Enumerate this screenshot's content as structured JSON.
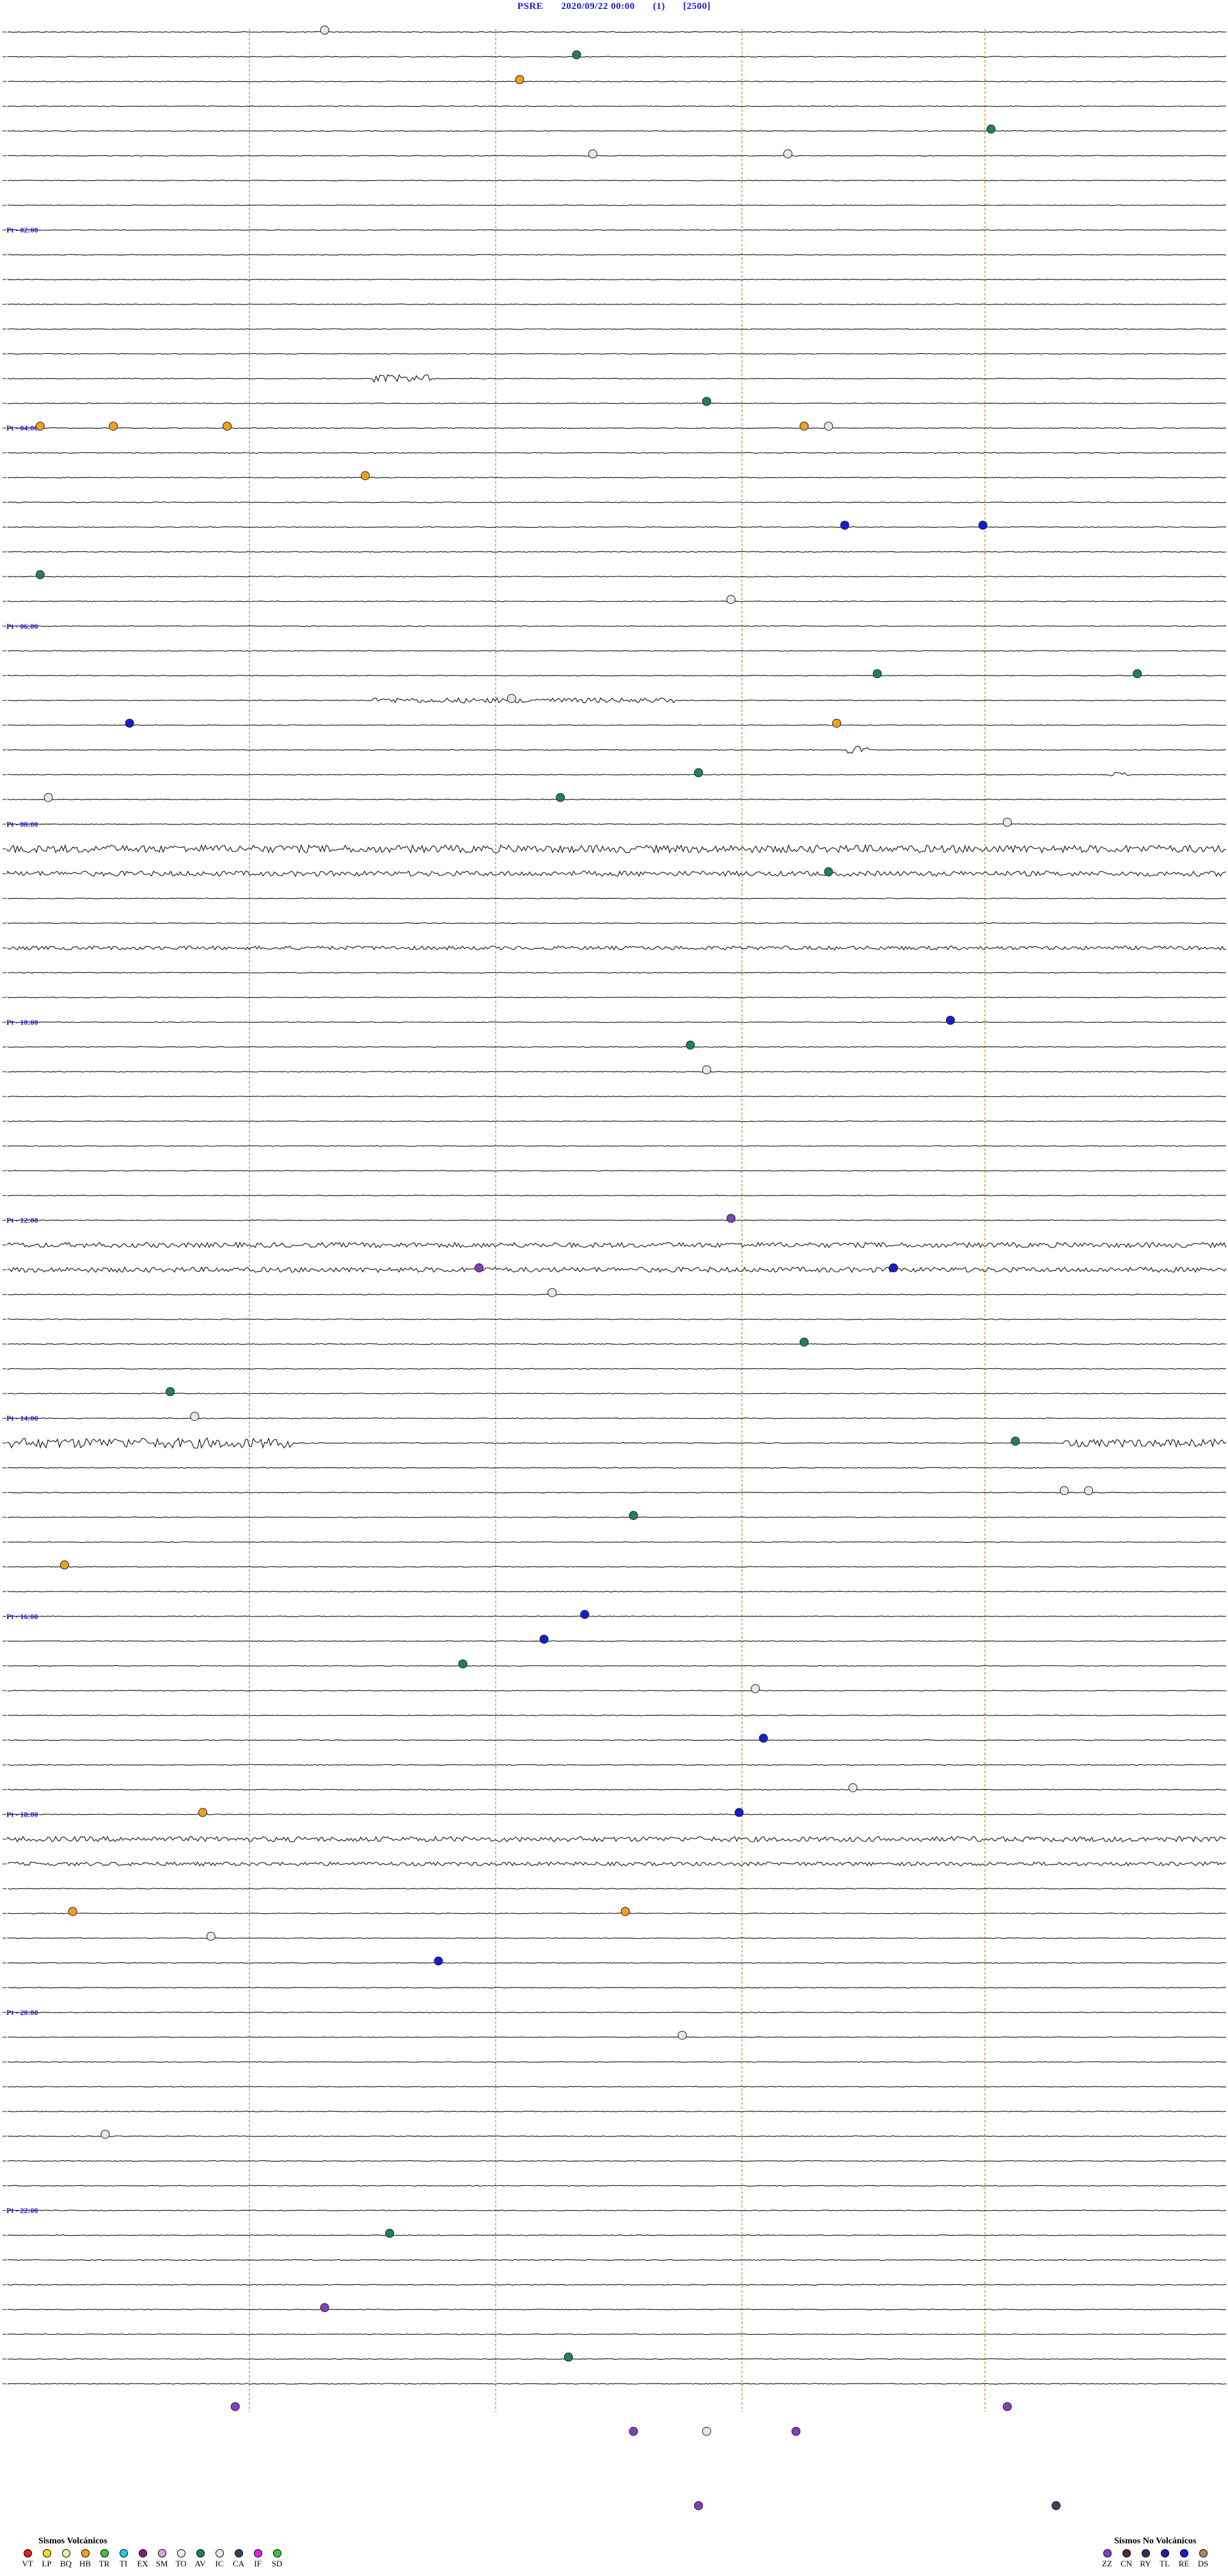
{
  "header": {
    "station": "PSRE",
    "datetime": "2020/09/22 00:00",
    "component": "(1)",
    "scale": "[2500]"
  },
  "colors": {
    "trace": "#111111",
    "minute_marker": "#e07a2a",
    "hour_label": "#1a1ad0",
    "minute_tick": "#c0392b"
  },
  "chart_data": {
    "type": "helicorder",
    "hour_labels": [
      "02:00",
      "04:00",
      "06:00",
      "08:00",
      "10:00",
      "12:00",
      "14:00",
      "16:00",
      "18:00",
      "20:00",
      "22:00"
    ],
    "line_count": 96,
    "line_minutes": 15,
    "events": [
      {
        "line": 0,
        "minute": 3.9,
        "type": "IC"
      },
      {
        "line": 1,
        "minute": 7.0,
        "type": "AV"
      },
      {
        "line": 2,
        "minute": 6.3,
        "type": "HB"
      },
      {
        "line": 4,
        "minute": 12.1,
        "type": "AV"
      },
      {
        "line": 5,
        "minute": 7.2,
        "type": "IC"
      },
      {
        "line": 5,
        "minute": 9.6,
        "type": "IC"
      },
      {
        "line": 15,
        "minute": 8.6,
        "type": "AV"
      },
      {
        "line": 16,
        "minute": 10.1,
        "type": "IC"
      },
      {
        "line": 16,
        "minute": 0.4,
        "type": "HB"
      },
      {
        "line": 16,
        "minute": 1.3,
        "type": "HB"
      },
      {
        "line": 16,
        "minute": 2.7,
        "type": "HB"
      },
      {
        "line": 16,
        "minute": 9.8,
        "type": "HB"
      },
      {
        "line": 18,
        "minute": 4.4,
        "type": "HB"
      },
      {
        "line": 20,
        "minute": 10.3,
        "type": "RE"
      },
      {
        "line": 20,
        "minute": 12.0,
        "type": "RE"
      },
      {
        "line": 22,
        "minute": 0.4,
        "type": "AV"
      },
      {
        "line": 23,
        "minute": 8.9,
        "type": "IC"
      },
      {
        "line": 26,
        "minute": 10.7,
        "type": "AV"
      },
      {
        "line": 26,
        "minute": 13.9,
        "type": "AV"
      },
      {
        "line": 27,
        "minute": 6.2,
        "type": "IC"
      },
      {
        "line": 28,
        "minute": 1.5,
        "type": "RE"
      },
      {
        "line": 28,
        "minute": 10.2,
        "type": "HB"
      },
      {
        "line": 30,
        "minute": 8.5,
        "type": "AV"
      },
      {
        "line": 31,
        "minute": 0.5,
        "type": "IC"
      },
      {
        "line": 31,
        "minute": 6.8,
        "type": "AV"
      },
      {
        "line": 32,
        "minute": 12.3,
        "type": "IC"
      },
      {
        "line": 34,
        "minute": 10.1,
        "type": "AV"
      },
      {
        "line": 40,
        "minute": 11.6,
        "type": "RE"
      },
      {
        "line": 41,
        "minute": 8.4,
        "type": "AV"
      },
      {
        "line": 42,
        "minute": 8.6,
        "type": "IC"
      },
      {
        "line": 48,
        "minute": 8.9,
        "type": "ZZ"
      },
      {
        "line": 50,
        "minute": 5.8,
        "type": "ZZ"
      },
      {
        "line": 50,
        "minute": 10.9,
        "type": "RE"
      },
      {
        "line": 51,
        "minute": 6.7,
        "type": "IC"
      },
      {
        "line": 53,
        "minute": 9.8,
        "type": "AV"
      },
      {
        "line": 55,
        "minute": 2.0,
        "type": "AV"
      },
      {
        "line": 56,
        "minute": 2.3,
        "type": "IC"
      },
      {
        "line": 57,
        "minute": 12.4,
        "type": "AV"
      },
      {
        "line": 59,
        "minute": 13.0,
        "type": "IC"
      },
      {
        "line": 59,
        "minute": 13.3,
        "type": "IC"
      },
      {
        "line": 60,
        "minute": 7.7,
        "type": "AV"
      },
      {
        "line": 62,
        "minute": 0.7,
        "type": "HB"
      },
      {
        "line": 64,
        "minute": 7.1,
        "type": "RE"
      },
      {
        "line": 65,
        "minute": 6.6,
        "type": "RE"
      },
      {
        "line": 66,
        "minute": 5.6,
        "type": "AV"
      },
      {
        "line": 67,
        "minute": 9.2,
        "type": "IC"
      },
      {
        "line": 69,
        "minute": 9.3,
        "type": "RE"
      },
      {
        "line": 71,
        "minute": 10.4,
        "type": "IC"
      },
      {
        "line": 72,
        "minute": 9.0,
        "type": "RE"
      },
      {
        "line": 72,
        "minute": 2.4,
        "type": "HB"
      },
      {
        "line": 76,
        "minute": 0.8,
        "type": "HB"
      },
      {
        "line": 76,
        "minute": 7.6,
        "type": "HB"
      },
      {
        "line": 77,
        "minute": 2.5,
        "type": "IC"
      },
      {
        "line": 78,
        "minute": 5.3,
        "type": "RE"
      },
      {
        "line": 81,
        "minute": 8.3,
        "type": "IC"
      },
      {
        "line": 85,
        "minute": 1.2,
        "type": "IC"
      },
      {
        "line": 89,
        "minute": 4.7,
        "type": "AV"
      },
      {
        "line": 92,
        "minute": 3.9,
        "type": "ZZ"
      },
      {
        "line": 94,
        "minute": 6.9,
        "type": "AV"
      },
      {
        "line": 96,
        "minute": 2.8,
        "type": "ZZ"
      },
      {
        "line": 96,
        "minute": 12.3,
        "type": "ZZ"
      },
      {
        "line": 97,
        "minute": 7.7,
        "type": "ZZ"
      },
      {
        "line": 97,
        "minute": 8.6,
        "type": "IC"
      },
      {
        "line": 97,
        "minute": 9.7,
        "type": "ZZ"
      },
      {
        "line": 100,
        "minute": 8.5,
        "type": "ZZ"
      },
      {
        "line": 100,
        "minute": 12.9,
        "type": "CA"
      }
    ],
    "noise_bands": [
      {
        "line": 14,
        "from": 4.5,
        "to": 5.2,
        "amp": 3
      },
      {
        "line": 27,
        "from": 4.5,
        "to": 8.2,
        "amp": 2
      },
      {
        "line": 29,
        "from": 10.3,
        "to": 10.6,
        "amp": 3
      },
      {
        "line": 30,
        "from": 13.5,
        "to": 13.8,
        "amp": 2
      },
      {
        "line": 33,
        "from": 0.0,
        "to": 15.0,
        "amp": 3
      },
      {
        "line": 34,
        "from": 0.0,
        "to": 15.0,
        "amp": 2
      },
      {
        "line": 37,
        "from": 0.0,
        "to": 15.0,
        "amp": 1.5
      },
      {
        "line": 49,
        "from": 0.0,
        "to": 15.0,
        "amp": 2
      },
      {
        "line": 50,
        "from": 0.0,
        "to": 15.0,
        "amp": 2
      },
      {
        "line": 57,
        "from": 0.0,
        "to": 3.5,
        "amp": 4
      },
      {
        "line": 57,
        "from": 13.0,
        "to": 15.0,
        "amp": 3
      },
      {
        "line": 73,
        "from": 0.0,
        "to": 15.0,
        "amp": 2
      },
      {
        "line": 74,
        "from": 0.0,
        "to": 15.0,
        "amp": 1.5
      }
    ]
  },
  "legend": {
    "volcanic_title": "Sismos Volcánicos",
    "volcanic": [
      {
        "code": "VT",
        "color": "#e02020"
      },
      {
        "code": "LP",
        "color": "#f0e020"
      },
      {
        "code": "BQ",
        "color": "#f0f0a0"
      },
      {
        "code": "HB",
        "color": "#f0a020"
      },
      {
        "code": "TR",
        "color": "#40c040"
      },
      {
        "code": "TI",
        "color": "#20d0e0"
      },
      {
        "code": "EX",
        "color": "#802080"
      },
      {
        "code": "SM",
        "color": "#e0a0e0"
      },
      {
        "code": "TO",
        "color": "#f0f0f0"
      },
      {
        "code": "AV",
        "color": "#208060"
      },
      {
        "code": "IC",
        "color": "#e8e8e8"
      },
      {
        "code": "CA",
        "color": "#404060"
      },
      {
        "code": "IF",
        "color": "#e020e0"
      },
      {
        "code": "SD",
        "color": "#40c040"
      }
    ],
    "nonvolcanic_title": "Sismos No Volcánicos",
    "nonvolcanic": [
      {
        "code": "ZZ",
        "color": "#8040c0"
      },
      {
        "code": "CN",
        "color": "#5a2a2a"
      },
      {
        "code": "RY",
        "color": "#303060"
      },
      {
        "code": "TL",
        "color": "#2020a0"
      },
      {
        "code": "RE",
        "color": "#1020d0"
      },
      {
        "code": "DS",
        "color": "#b08860"
      }
    ]
  }
}
